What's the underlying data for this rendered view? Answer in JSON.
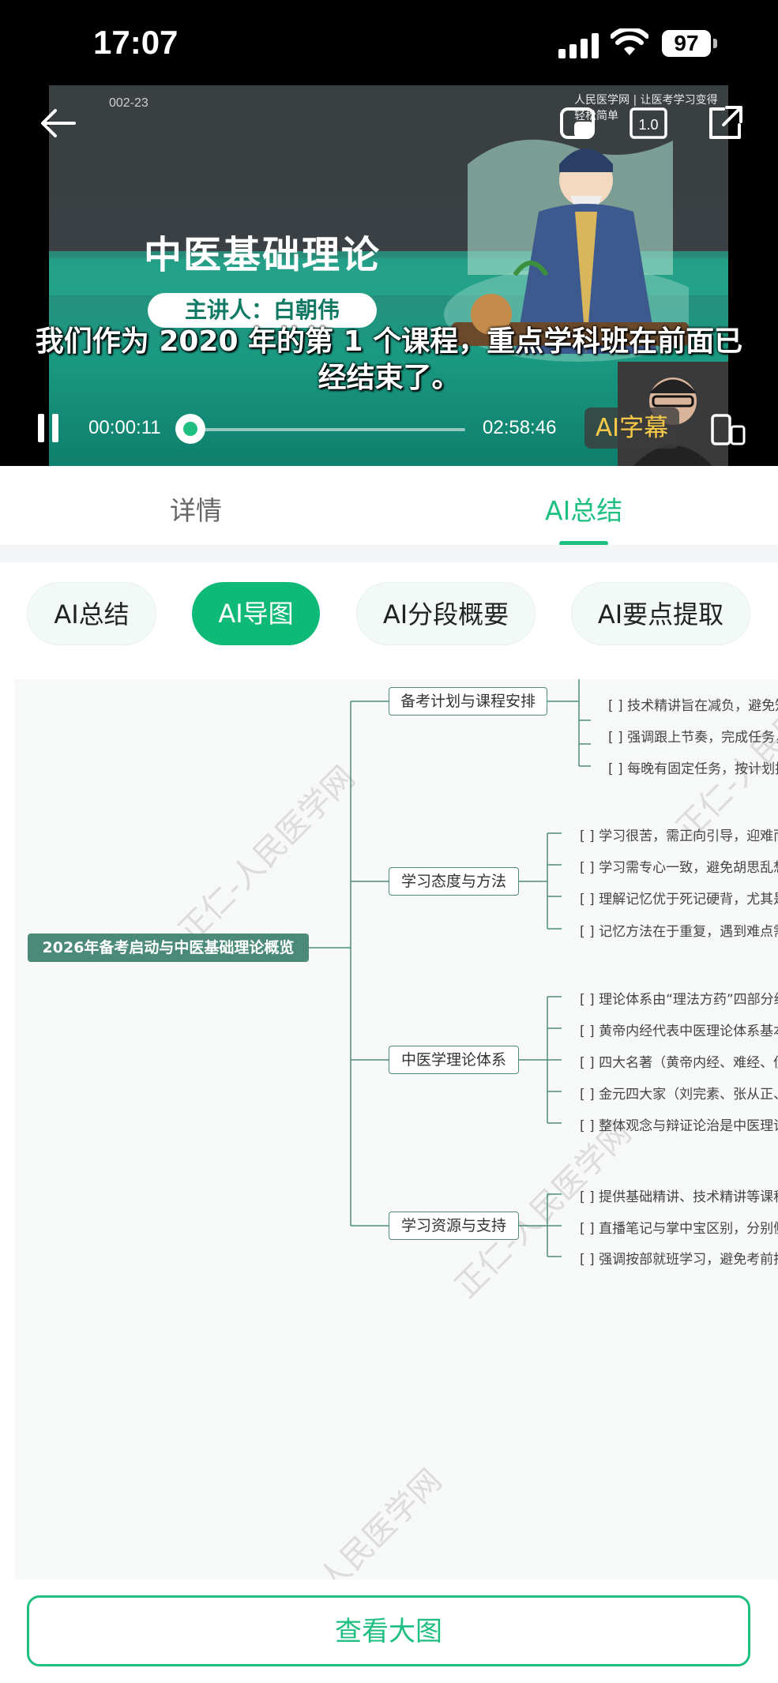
{
  "status_bar": {
    "time": "17:07",
    "battery": "97"
  },
  "video": {
    "counter": "002-23",
    "brand": "人民医学网 | 让医考学习变得轻松简单",
    "course_title": "中医基础理论",
    "lecturer": "主讲人：白朝伟",
    "subtitle": "我们作为 2020 年的第 1 个课程，重点学科班在前面已经结束了。",
    "current_time": "00:00:11",
    "total_time": "02:58:46",
    "speed": "1.0",
    "ai_subtitle_label": "AI字幕",
    "progress_fraction": 0.001
  },
  "tabs": {
    "detail": "详情",
    "ai_summary": "AI总结"
  },
  "chips": [
    "AI总结",
    "AI导图",
    "AI分段概要",
    "AI要点提取"
  ],
  "mindmap": {
    "root": "2026年备考启动与中医基础理论概览",
    "branches": [
      {
        "label": "备考计划与课程安排",
        "leaves": [
          "[ ] 技术精讲旨在减负，避免知",
          "[ ] 强调跟上节奏，完成任务，",
          "[ ] 每晚有固定任务，按计划推"
        ]
      },
      {
        "label": "学习态度与方法",
        "leaves": [
          "[ ] 学习很苦，需正向引导，迎难而上",
          "[ ] 学习需专心一致，避免胡思乱想",
          "[ ] 理解记忆优于死记硬背，尤其是",
          "[ ] 记忆方法在于重复，遇到难点需"
        ]
      },
      {
        "label": "中医学理论体系",
        "leaves": [
          "[ ] 理论体系由“理法方药”四部分组",
          "[ ] 黄帝内经代表中医理论体系基本",
          "[ ] 四大名著（黄帝内经、难经、伤",
          "[ ] 金元四大家（刘完素、张从正、",
          "[ ] 整体观念与辩证论治是中医理论"
        ]
      },
      {
        "label": "学习资源与支持",
        "leaves": [
          "[ ] 提供基础精讲、技术精讲等课程",
          "[ ] 直播笔记与掌中宝区别，分别侧",
          "[ ] 强调按部就班学习，避免考前抱"
        ]
      }
    ],
    "watermark": "正仁-人民医学网"
  },
  "bottom": {
    "view_large": "查看大图"
  }
}
